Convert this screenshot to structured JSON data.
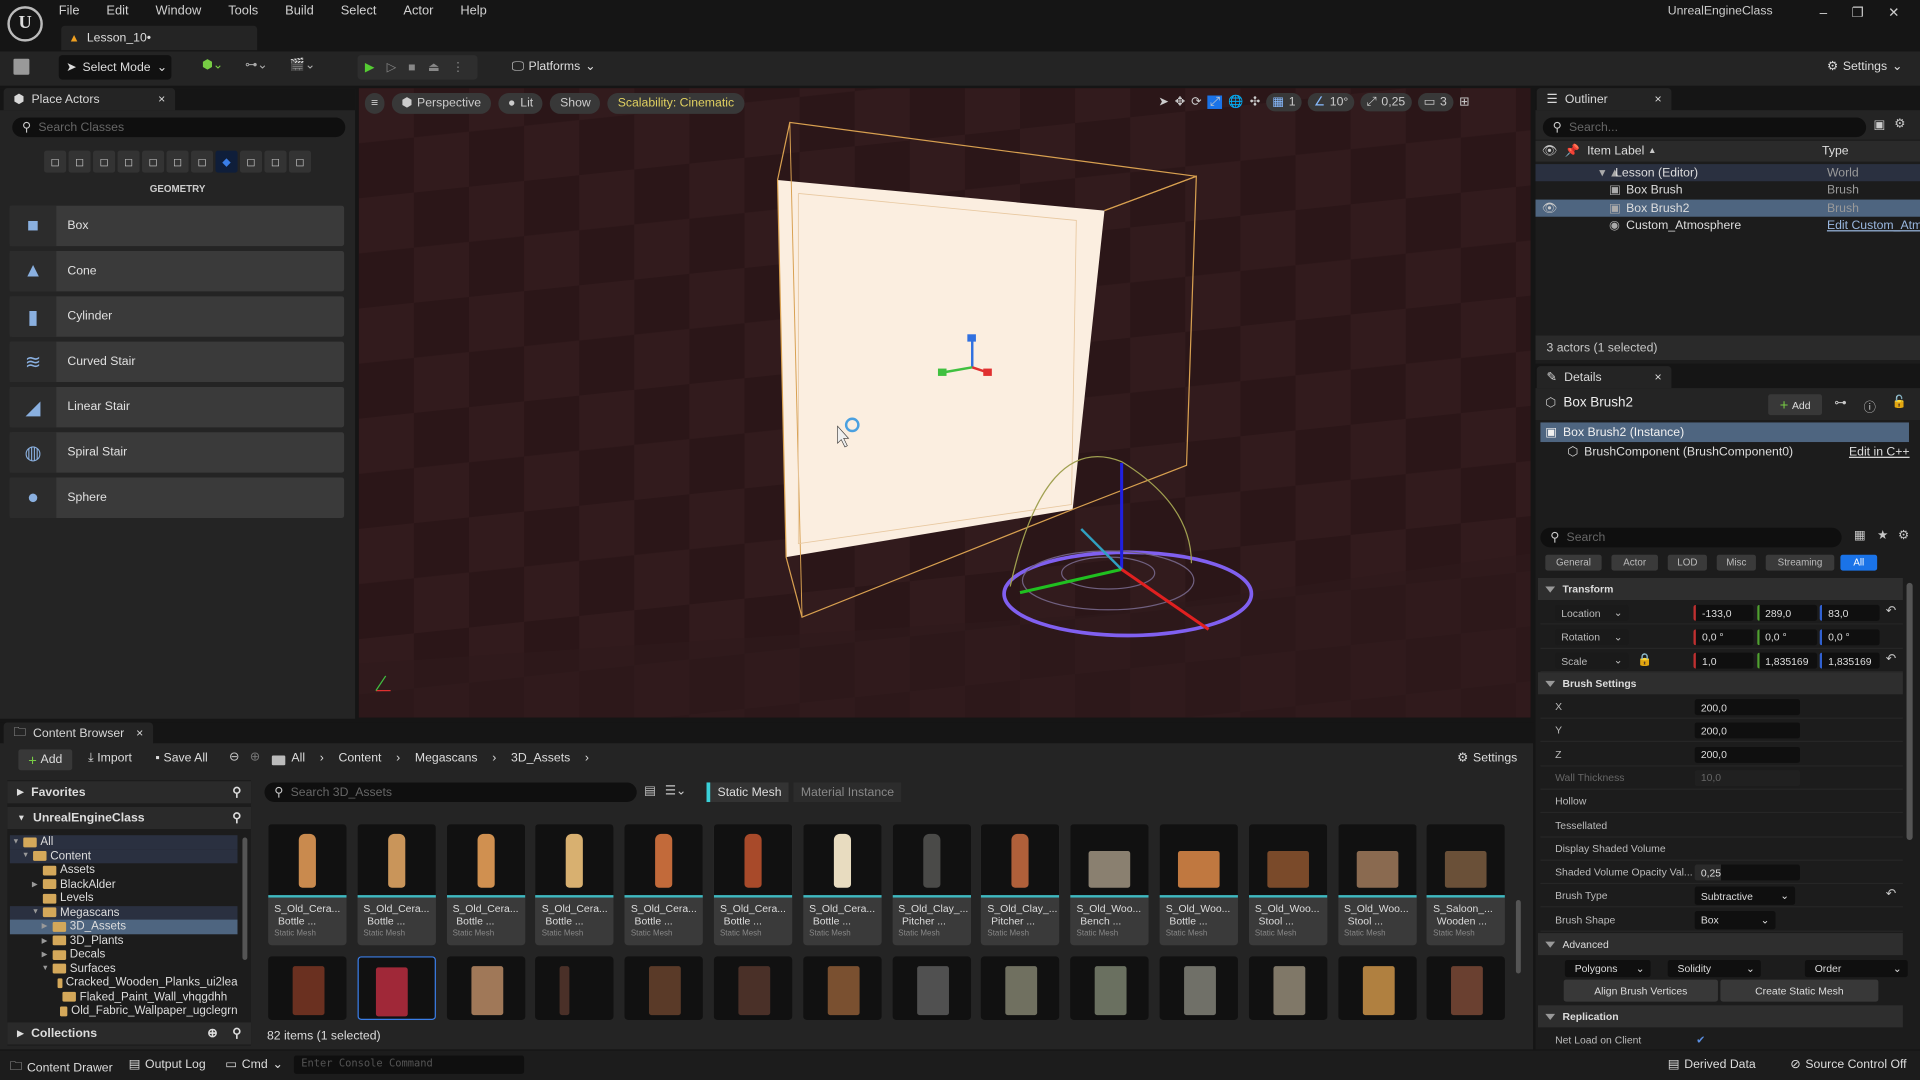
{
  "app": {
    "project_name": "UnrealEngineClass",
    "level_tab": "Lesson_10•",
    "menu": [
      "File",
      "Edit",
      "Window",
      "Tools",
      "Build",
      "Select",
      "Actor",
      "Help"
    ]
  },
  "toolbar": {
    "select_mode": "Select Mode",
    "platforms": "Platforms",
    "settings": "Settings"
  },
  "viewport": {
    "menu_icon": "hamburger-icon",
    "perspective": "Perspective",
    "lit": "Lit",
    "show": "Show",
    "scalability": "Scalability: Cinematic",
    "grid_snap": "1",
    "rotation_snap": "10°",
    "scale_snap": "0,25",
    "camera_speed": "3",
    "accent": "#1a73e8"
  },
  "place_actors": {
    "title": "Place Actors",
    "search_placeholder": "Search Classes",
    "category": "GEOMETRY",
    "items": [
      {
        "label": "Box"
      },
      {
        "label": "Cone"
      },
      {
        "label": "Cylinder"
      },
      {
        "label": "Curved Stair"
      },
      {
        "label": "Linear Stair"
      },
      {
        "label": "Spiral Stair"
      },
      {
        "label": "Sphere"
      }
    ]
  },
  "outliner": {
    "title": "Outliner",
    "search_placeholder": "Search...",
    "col_label": "Item Label",
    "col_type": "Type",
    "rows": [
      {
        "label": "Lesson (Editor)",
        "type": "World"
      },
      {
        "label": "Box Brush",
        "type": "Brush"
      },
      {
        "label": "Box Brush2",
        "type": "Brush",
        "selected": true
      },
      {
        "label": "Custom_Atmosphere",
        "type": "Edit Custom_Atm"
      }
    ],
    "status": "3 actors (1 selected)"
  },
  "details": {
    "title": "Details",
    "actor": "Box Brush2",
    "add": "Add",
    "instance": "Box Brush2 (Instance)",
    "component": "BrushComponent (BrushComponent0)",
    "edit_cpp": "Edit in C++",
    "search_placeholder": "Search",
    "filters": [
      "General",
      "Actor",
      "LOD",
      "Misc",
      "Streaming",
      "All"
    ],
    "active_filter": "All",
    "transform": {
      "title": "Transform",
      "location_label": "Location",
      "location": [
        "-133,0",
        "289,0",
        "83,0"
      ],
      "rotation_label": "Rotation",
      "rotation": [
        "0,0 °",
        "0,0 °",
        "0,0 °"
      ],
      "scale_label": "Scale",
      "scale": [
        "1,0",
        "1,835169",
        "1,835169"
      ]
    },
    "brush": {
      "title": "Brush Settings",
      "x_label": "X",
      "x": "200,0",
      "y_label": "Y",
      "y": "200,0",
      "z_label": "Z",
      "z": "200,0",
      "wall_label": "Wall Thickness",
      "wall": "10,0",
      "hollow_label": "Hollow",
      "hollow": false,
      "tess_label": "Tessellated",
      "tess": false,
      "shaded_label": "Display Shaded Volume",
      "shaded": false,
      "opacity_label": "Shaded Volume Opacity Val...",
      "opacity": "0,25",
      "type_label": "Brush Type",
      "type": "Subtractive",
      "shape_label": "Brush Shape",
      "shape": "Box"
    },
    "advanced": {
      "title": "Advanced",
      "polygons": "Polygons",
      "solidity": "Solidity",
      "order": "Order",
      "align": "Align Brush Vertices",
      "create": "Create Static Mesh"
    },
    "replication": {
      "title": "Replication",
      "net_load_label": "Net Load on Client",
      "net_load": true
    }
  },
  "content_browser": {
    "title": "Content Browser",
    "add": "Add",
    "import": "Import",
    "save_all": "Save All",
    "breadcrumb": [
      "All",
      "Content",
      "Megascans",
      "3D_Assets"
    ],
    "settings": "Settings",
    "favorites": "Favorites",
    "project": "UnrealEngineClass",
    "collections": "Collections",
    "search_placeholder": "Search 3D_Assets",
    "filters": [
      "Static Mesh",
      "Material Instance"
    ],
    "status": "82 items (1 selected)",
    "tree": [
      {
        "label": "All",
        "d": 0
      },
      {
        "label": "Content",
        "d": 1
      },
      {
        "label": "Assets",
        "d": 2
      },
      {
        "label": "BlackAlder",
        "d": 2
      },
      {
        "label": "Levels",
        "d": 2
      },
      {
        "label": "Megascans",
        "d": 2
      },
      {
        "label": "3D_Assets",
        "d": 3,
        "selected": true
      },
      {
        "label": "3D_Plants",
        "d": 3
      },
      {
        "label": "Decals",
        "d": 3
      },
      {
        "label": "Surfaces",
        "d": 3
      },
      {
        "label": "Cracked_Wooden_Planks_ui2lea",
        "d": 4
      },
      {
        "label": "Flaked_Paint_Wall_vhqgdhh",
        "d": 4
      },
      {
        "label": "Old_Fabric_Wallpaper_ugclegrn",
        "d": 4
      }
    ],
    "assets": [
      {
        "n1": "S_Old_Cera...",
        "n2": "Bottle ...",
        "type": "Static Mesh",
        "color": "#c98a4e"
      },
      {
        "n1": "S_Old_Cera...",
        "n2": "Bottle ...",
        "type": "Static Mesh",
        "color": "#c9955a"
      },
      {
        "n1": "S_Old_Cera...",
        "n2": "Bottle ...",
        "type": "Static Mesh",
        "color": "#d09050"
      },
      {
        "n1": "S_Old_Cera...",
        "n2": "Bottle ...",
        "type": "Static Mesh",
        "color": "#d8b070"
      },
      {
        "n1": "S_Old_Cera...",
        "n2": "Bottle ...",
        "type": "Static Mesh",
        "color": "#c26a3a"
      },
      {
        "n1": "S_Old_Cera...",
        "n2": "Bottle ...",
        "type": "Static Mesh",
        "color": "#a84a2a"
      },
      {
        "n1": "S_Old_Cera...",
        "n2": "Bottle ...",
        "type": "Static Mesh",
        "color": "#e8dcc0"
      },
      {
        "n1": "S_Old_Clay_...",
        "n2": "Pitcher ...",
        "type": "Static Mesh",
        "color": "#4a4a48"
      },
      {
        "n1": "S_Old_Clay_...",
        "n2": "Pitcher ...",
        "type": "Static Mesh",
        "color": "#b0603a"
      },
      {
        "n1": "S_Old_Woo...",
        "n2": "Bench ...",
        "type": "Static Mesh",
        "color": "#8a8070"
      },
      {
        "n1": "S_Old_Woo...",
        "n2": "Bottle ...",
        "type": "Static Mesh",
        "color": "#c07840"
      },
      {
        "n1": "S_Old_Woo...",
        "n2": "Stool ...",
        "type": "Static Mesh",
        "color": "#7a4a2a"
      },
      {
        "n1": "S_Old_Woo...",
        "n2": "Stool ...",
        "type": "Static Mesh",
        "color": "#8a6a50"
      },
      {
        "n1": "S_Saloon_...",
        "n2": "Wooden ...",
        "type": "Static Mesh",
        "color": "#6a5038"
      }
    ],
    "assets_row2_colors": [
      "#6a3020",
      "#a02838",
      "#a07858",
      "#4a3028",
      "#5a3a28",
      "#4a3028",
      "#7a5030",
      "#505050",
      "#707060",
      "#6a7060",
      "#707068",
      "#807868",
      "#b08040",
      "#6a4030"
    ]
  },
  "statusbar": {
    "content_drawer": "Content Drawer",
    "output_log": "Output Log",
    "cmd": "Cmd",
    "console_placeholder": "Enter Console Command",
    "derived_data": "Derived Data",
    "source_control": "Source Control Off"
  }
}
